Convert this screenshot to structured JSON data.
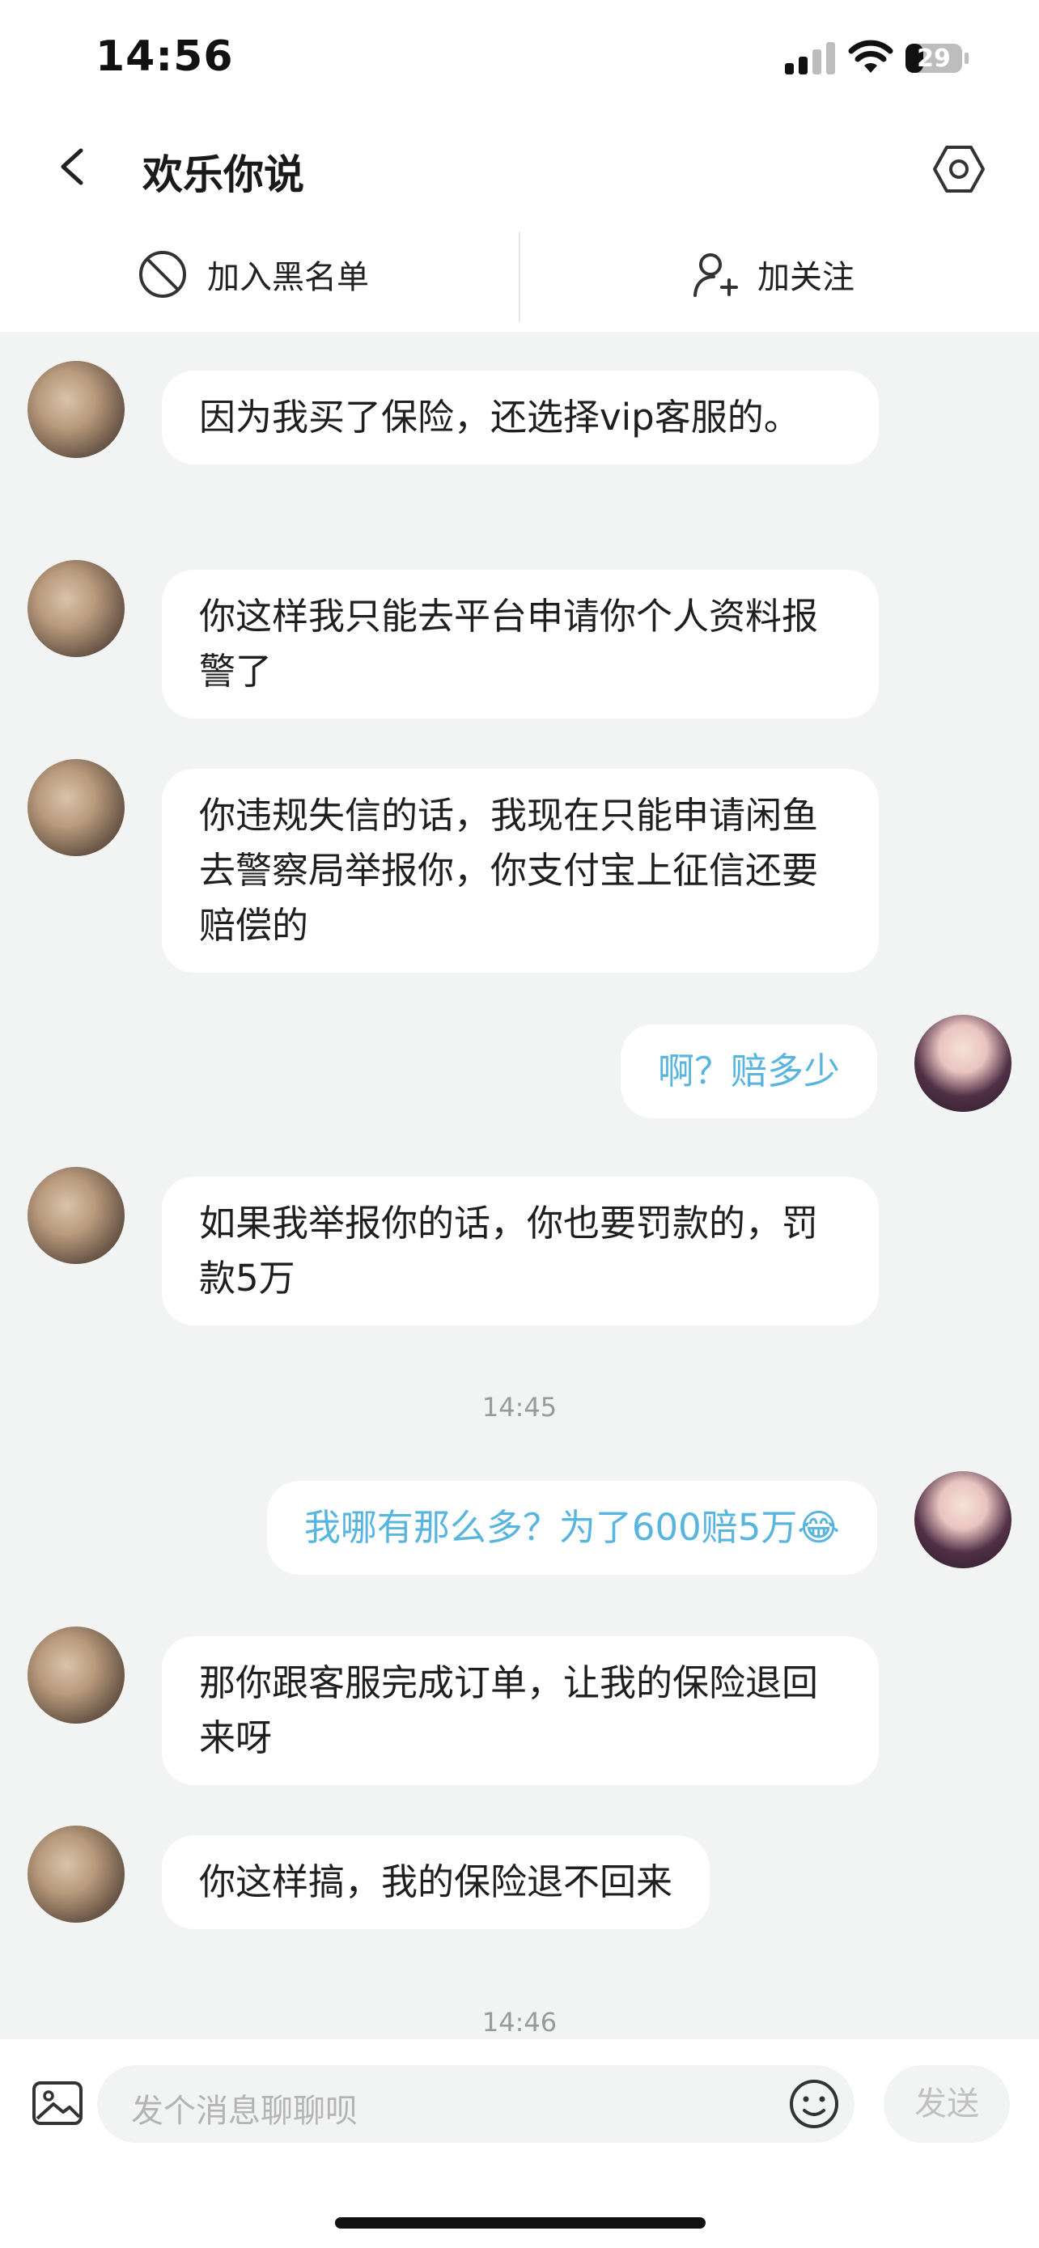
{
  "status": {
    "time": "14:56",
    "battery": "29"
  },
  "nav": {
    "title": "欢乐你说"
  },
  "actions": {
    "block": "加入黑名单",
    "follow": "加关注"
  },
  "messages": [
    {
      "from": "them",
      "text": "因为我买了保险，还选择vip客服的。"
    },
    {
      "from": "them",
      "text": "你这样我只能去平台申请你个人资料报警了"
    },
    {
      "from": "them",
      "text": "你违规失信的话，我现在只能申请闲鱼去警察局举报你，你支付宝上征信还要赔偿的"
    },
    {
      "from": "me",
      "text": "啊？赔多少"
    },
    {
      "from": "them",
      "text": "如果我举报你的话，你也要罚款的，罚款5万"
    },
    {
      "from": "me",
      "text": "我哪有那么多？为了600赔5万😂"
    },
    {
      "from": "them",
      "text": "那你跟客服完成订单，让我的保险退回来呀"
    },
    {
      "from": "them",
      "text": "你这样搞，我的保险退不回来"
    }
  ],
  "timestamps": [
    "14:45",
    "14:46"
  ],
  "input": {
    "placeholder": "发个消息聊聊呗",
    "send_label": "发送"
  }
}
